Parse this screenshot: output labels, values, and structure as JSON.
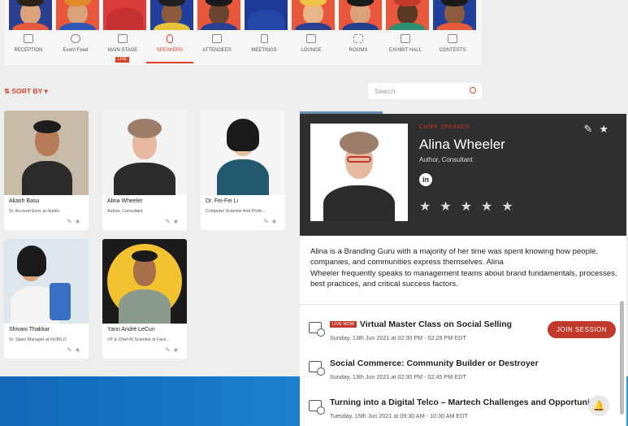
{
  "nav": {
    "items": [
      {
        "label": "RECEPTION"
      },
      {
        "label": "Event Feed"
      },
      {
        "label": "MAIN STAGE",
        "badge": "LIVE"
      },
      {
        "label": "SPEAKERS",
        "active": true
      },
      {
        "label": "ATTENDEES"
      },
      {
        "label": "MEETINGS"
      },
      {
        "label": "LOUNGE"
      },
      {
        "label": "ROOMS"
      },
      {
        "label": "EXHIBIT HALL"
      },
      {
        "label": "CONTESTS"
      }
    ]
  },
  "toolbar": {
    "sort_label": "SORT BY",
    "search_placeholder": "Search"
  },
  "speakers": [
    {
      "name": "Akash Basu",
      "desc": "Sr. Account Exec at Hubilo"
    },
    {
      "name": "Alina Wheeler",
      "desc": "Author, Consultant"
    },
    {
      "name": "Dr. Fei-Fei Li",
      "desc": "Computer Scientist And Profe..."
    },
    {
      "name": "Shivani Thakkar",
      "desc": "Sr. Sales Manager at HUBILO"
    },
    {
      "name": "Yann André LeCun",
      "desc": "VP & Chief AI Scientist at Face..."
    }
  ],
  "detail": {
    "role": "CHIEF SPEAKER",
    "name": "Alina Wheeler",
    "subtitle": "Author, Consultant",
    "social": "in",
    "bio": "Alina is a Branding Guru with a majority of her time was spent knowing how people, companies, and communities express themselves. Alina\n Wheeler frequently speaks to management teams about brand fundamentals, processes, best practices, and critical success factors.",
    "rating": 0,
    "sessions": [
      {
        "badge": "LIVE NOW",
        "title": "Virtual Master Class on Social Selling",
        "time": "Sunday, 13th Jun 2021 at 02:30 PM - 02:29 PM EDT",
        "action": "JOIN SESSION"
      },
      {
        "title": "Social Commerce: Community Builder or Destroyer",
        "time": "Sunday, 13th Jun 2021 at 02:30 PM - 02:45 PM EDT"
      },
      {
        "title": "Turning into a Digital Telco – Martech Challenges and Opportunities",
        "time": "Tuesday, 15th Jun 2021 at 09:30 AM - 10:30 AM EDT"
      }
    ]
  },
  "colors": {
    "accent": "#d9412b",
    "panel_dark": "#2f2f2f",
    "background": "#eeeeee",
    "footer_blue": "#1c86d6"
  }
}
